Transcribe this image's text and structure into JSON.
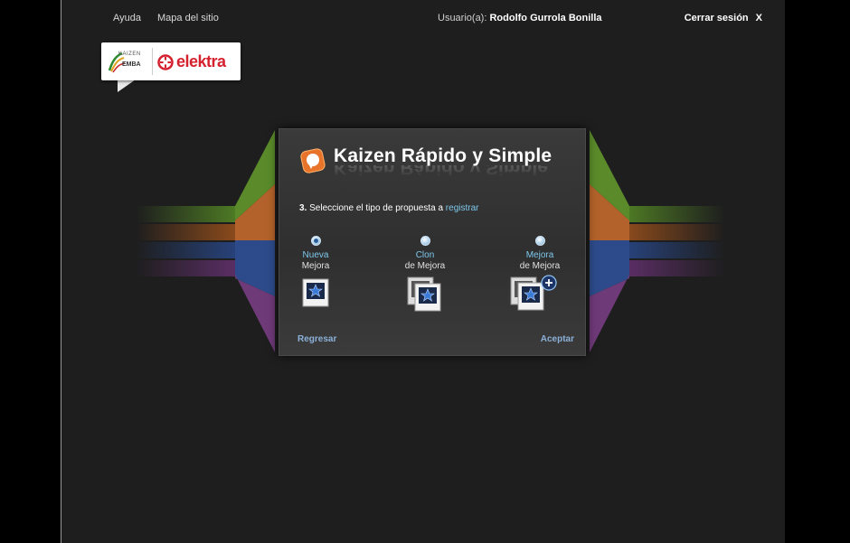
{
  "topbar": {
    "help": "Ayuda",
    "sitemap": "Mapa del sitio",
    "user_label": "Usuario(a):",
    "user_name": "Rodolfo Gurrola Bonilla",
    "logout": "Cerrar sesión",
    "logout_x": "X"
  },
  "logo": {
    "kaizen_top": "KAIZEN",
    "kaizen_bottom": "EMBA",
    "brand": "elektra"
  },
  "panel": {
    "title": "Kaizen Rápido y Simple",
    "instruction_step": "3.",
    "instruction_text": "Seleccione el tipo de propuesta a",
    "instruction_highlight": "registrar",
    "options": [
      {
        "line1": "Nueva",
        "line2": "Mejora",
        "selected": true
      },
      {
        "line1": "Clon",
        "line2": "de Mejora",
        "selected": false
      },
      {
        "line1": "Mejora",
        "line2": "de Mejora",
        "selected": false
      }
    ],
    "back": "Regresar",
    "accept": "Aceptar"
  },
  "colors": {
    "accent": "#7ec8ec",
    "button": "#8cb0d8",
    "stripe_green": "#5a8a2a",
    "stripe_orange": "#b2622a",
    "stripe_blue": "#2d4b8a",
    "stripe_purple": "#6e3a78",
    "brand_red": "#d5202e"
  }
}
